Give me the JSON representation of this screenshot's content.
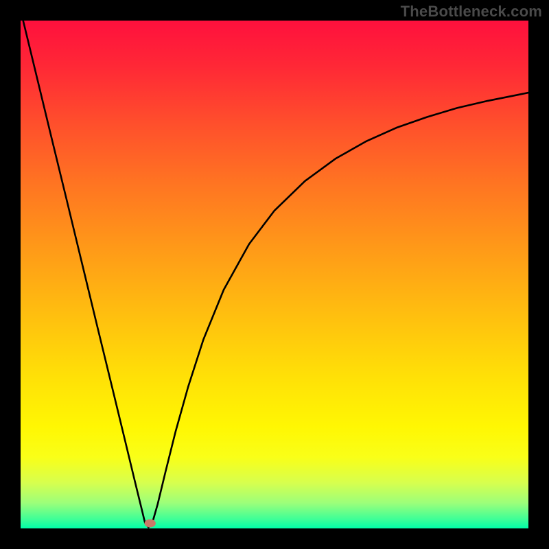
{
  "attribution": "TheBottleneck.com",
  "chart_data": {
    "type": "line",
    "title": "",
    "xlabel": "",
    "ylabel": "",
    "xlim": [
      0,
      100
    ],
    "ylim": [
      0,
      100
    ],
    "grid": false,
    "legend": false,
    "background_gradient_stops": [
      {
        "offset": 0.0,
        "color": "#ff103d"
      },
      {
        "offset": 0.09,
        "color": "#ff2836"
      },
      {
        "offset": 0.2,
        "color": "#ff4e2c"
      },
      {
        "offset": 0.32,
        "color": "#ff7422"
      },
      {
        "offset": 0.45,
        "color": "#ff9a18"
      },
      {
        "offset": 0.58,
        "color": "#ffbf0f"
      },
      {
        "offset": 0.7,
        "color": "#ffe007"
      },
      {
        "offset": 0.8,
        "color": "#fff703"
      },
      {
        "offset": 0.86,
        "color": "#f9ff18"
      },
      {
        "offset": 0.91,
        "color": "#d7ff4e"
      },
      {
        "offset": 0.95,
        "color": "#9cff7a"
      },
      {
        "offset": 0.985,
        "color": "#34ff9a"
      },
      {
        "offset": 1.0,
        "color": "#00ffa8"
      }
    ],
    "series": [
      {
        "name": "bottleneck-curve",
        "color": "#000000",
        "x": [
          0.5,
          3,
          6,
          9,
          12,
          15,
          18,
          20.5,
          22.5,
          23.8,
          24.5,
          25.2,
          26.0,
          27.0,
          28.5,
          30.5,
          33,
          36,
          40,
          45,
          50,
          56,
          62,
          68,
          74,
          80,
          86,
          92,
          98,
          100
        ],
        "y": [
          100,
          89.7,
          77.3,
          65.0,
          52.6,
          40.2,
          27.9,
          17.6,
          9.3,
          4.0,
          1.1,
          0.2,
          1.3,
          4.8,
          11.0,
          19.0,
          27.9,
          37.2,
          47.0,
          56.0,
          62.6,
          68.4,
          72.8,
          76.2,
          78.9,
          81.0,
          82.8,
          84.2,
          85.4,
          85.8
        ]
      }
    ],
    "marker": {
      "x": 25.5,
      "y": 1.0,
      "rx": 1.1,
      "ry": 0.8,
      "color": "#c97968"
    }
  }
}
